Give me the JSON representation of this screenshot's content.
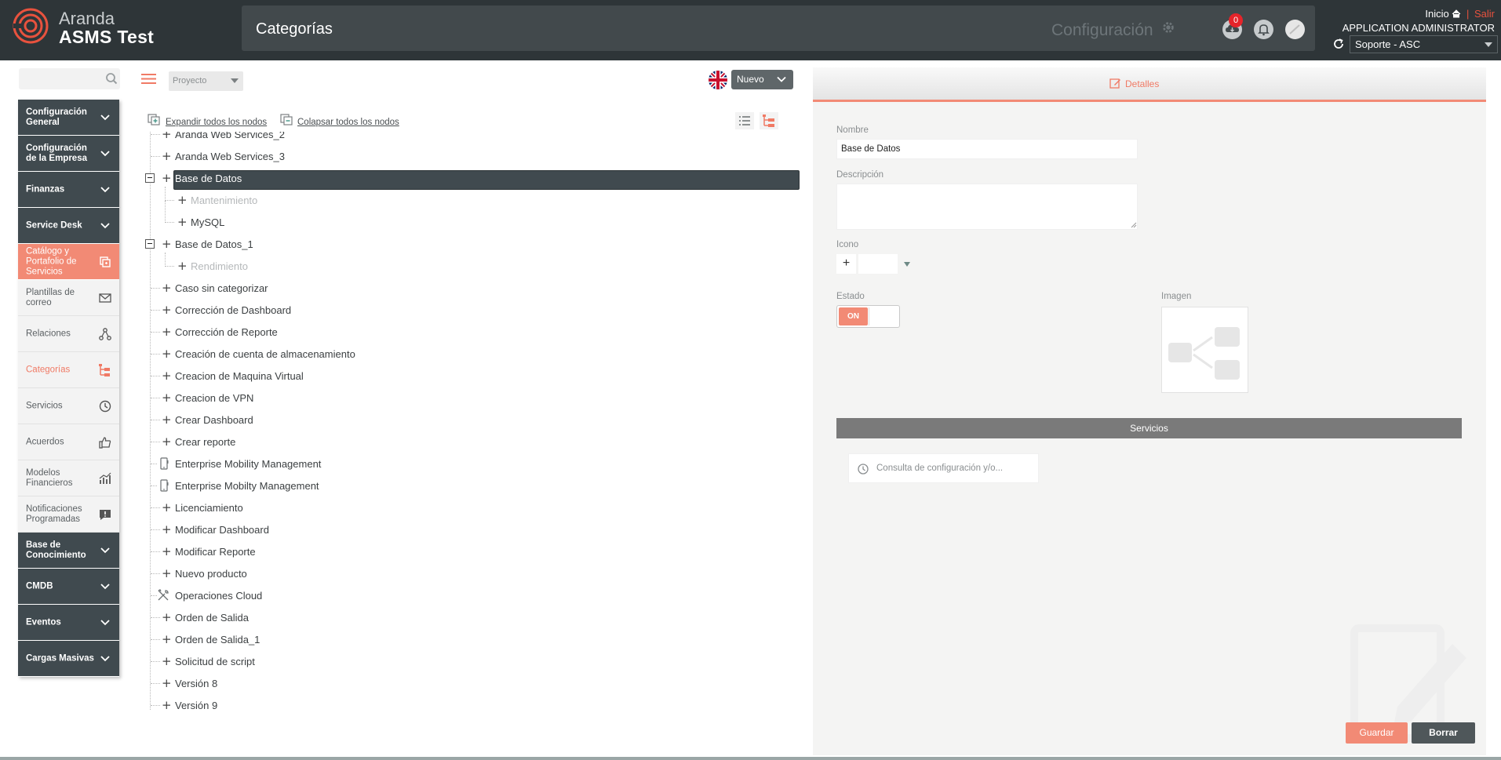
{
  "brand": {
    "top": "Aranda",
    "bottom": "ASMS Test",
    "accent": "#e8523e"
  },
  "header": {
    "title": "Categorías",
    "config_label": "Configuración",
    "badge_count": "0",
    "home_label": "Inicio",
    "logout_label": "Salir",
    "user_name": "APPLICATION ADMINISTRATOR",
    "project": "Soporte - ASC"
  },
  "search": {
    "placeholder": ""
  },
  "nav": {
    "items": [
      {
        "label": "Configuración General",
        "kind": "group"
      },
      {
        "label": "Configuración de la Empresa",
        "kind": "group"
      },
      {
        "label": "Finanzas",
        "kind": "group"
      },
      {
        "label": "Service Desk",
        "kind": "group"
      },
      {
        "label": "Catálogo y Portafolio de Servicios",
        "kind": "active",
        "icon": "catalog-icon"
      },
      {
        "label": "Plantillas de correo",
        "kind": "sub",
        "icon": "mail-icon"
      },
      {
        "label": "Relaciones",
        "kind": "sub",
        "icon": "relations-icon"
      },
      {
        "label": "Categorías",
        "kind": "sub-selected",
        "icon": "categories-icon"
      },
      {
        "label": "Servicios",
        "kind": "sub",
        "icon": "services-icon"
      },
      {
        "label": "Acuerdos",
        "kind": "sub",
        "icon": "thumbs-up-icon"
      },
      {
        "label": "Modelos Financieros",
        "kind": "sub",
        "icon": "chart-icon"
      },
      {
        "label": "Notificaciones Programadas",
        "kind": "sub",
        "icon": "notification-icon"
      },
      {
        "label": "Base de Conocimiento",
        "kind": "group"
      },
      {
        "label": "CMDB",
        "kind": "group"
      },
      {
        "label": "Eventos",
        "kind": "group"
      },
      {
        "label": "Cargas Masivas",
        "kind": "group"
      }
    ]
  },
  "toolbar": {
    "type_select": "Proyecto",
    "new_button": "Nuevo",
    "expand_all": "Expandir todos los nodos",
    "collapse_all": "Colapsar todos los nodos"
  },
  "tree": {
    "items": [
      {
        "label": "Aranda Web Services_2",
        "level": 0,
        "prefix": "plus"
      },
      {
        "label": "Aranda Web Services_3",
        "level": 0,
        "prefix": "plus"
      },
      {
        "label": "Base de Datos",
        "level": 0,
        "prefix": "plus",
        "selected": true,
        "expanded": true
      },
      {
        "label": "Mantenimiento",
        "level": 1,
        "prefix": "plus",
        "muted": true
      },
      {
        "label": "MySQL",
        "level": 1,
        "prefix": "plus"
      },
      {
        "label": "Base de Datos_1",
        "level": 0,
        "prefix": "plus",
        "expanded": true
      },
      {
        "label": "Rendimiento",
        "level": 1,
        "prefix": "plus",
        "muted": true
      },
      {
        "label": "Caso sin categorizar",
        "level": 0,
        "prefix": "plus"
      },
      {
        "label": "Corrección de Dashboard",
        "level": 0,
        "prefix": "plus"
      },
      {
        "label": "Corrección de Reporte",
        "level": 0,
        "prefix": "plus"
      },
      {
        "label": "Creación de cuenta de almacenamiento",
        "level": 0,
        "prefix": "plus"
      },
      {
        "label": "Creacion de Maquina Virtual",
        "level": 0,
        "prefix": "plus"
      },
      {
        "label": "Creacion de VPN",
        "level": 0,
        "prefix": "plus"
      },
      {
        "label": "Crear Dashboard",
        "level": 0,
        "prefix": "plus"
      },
      {
        "label": "Crear reporte",
        "level": 0,
        "prefix": "plus"
      },
      {
        "label": "Enterprise Mobility Management",
        "level": 0,
        "prefix": "mobile-icon"
      },
      {
        "label": "Enterprise Mobilty Management",
        "level": 0,
        "prefix": "mobile-icon"
      },
      {
        "label": "Licenciamiento",
        "level": 0,
        "prefix": "plus"
      },
      {
        "label": "Modificar Dashboard",
        "level": 0,
        "prefix": "plus"
      },
      {
        "label": "Modificar Reporte",
        "level": 0,
        "prefix": "plus"
      },
      {
        "label": "Nuevo producto",
        "level": 0,
        "prefix": "plus"
      },
      {
        "label": "Operaciones Cloud",
        "level": 0,
        "prefix": "tools-icon"
      },
      {
        "label": "Orden de Salida",
        "level": 0,
        "prefix": "plus"
      },
      {
        "label": "Orden de Salida_1",
        "level": 0,
        "prefix": "plus"
      },
      {
        "label": "Solicitud de script",
        "level": 0,
        "prefix": "plus"
      },
      {
        "label": "Versión 8",
        "level": 0,
        "prefix": "plus"
      },
      {
        "label": "Versión 9",
        "level": 0,
        "prefix": "plus"
      }
    ]
  },
  "detail": {
    "tab": "Detalles",
    "name_label": "Nombre",
    "name_value": "Base de Datos",
    "description_label": "Descripción",
    "description_value": "",
    "icon_label": "Icono",
    "icon_add": "+",
    "state_label": "Estado",
    "state_value": "ON",
    "image_label": "Imagen",
    "services_title": "Servicios",
    "service_placeholder": "Consulta de configuración y/o...",
    "save_label": "Guardar",
    "delete_label": "Borrar"
  },
  "colors": {
    "header_bg": "#2e3538",
    "accent": "#f28a75",
    "nav_dark": "#404a4f"
  }
}
